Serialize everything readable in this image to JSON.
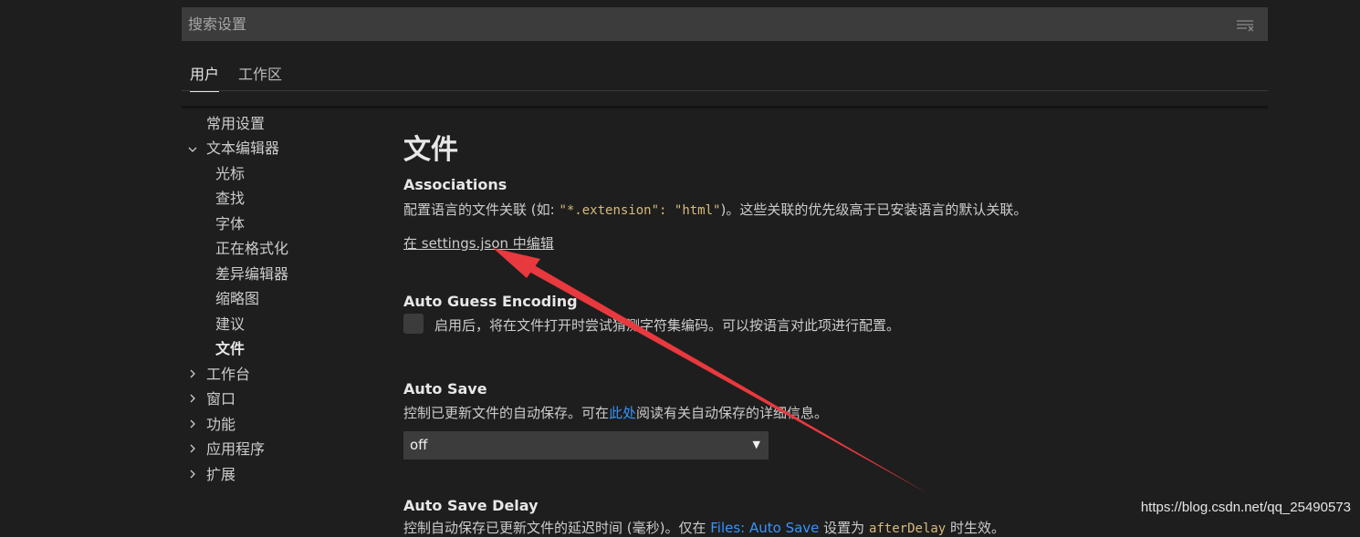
{
  "search": {
    "placeholder": "搜索设置",
    "value": ""
  },
  "tabs": [
    {
      "label": "用户",
      "active": true
    },
    {
      "label": "工作区",
      "active": false
    }
  ],
  "toc": [
    {
      "label": "常用设置"
    },
    {
      "label": "文本编辑器",
      "expanded": true
    },
    {
      "label": "光标"
    },
    {
      "label": "查找"
    },
    {
      "label": "字体"
    },
    {
      "label": "正在格式化"
    },
    {
      "label": "差异编辑器"
    },
    {
      "label": "缩略图"
    },
    {
      "label": "建议"
    },
    {
      "label": "文件",
      "selected": true
    },
    {
      "label": "工作台",
      "expanded": false
    },
    {
      "label": "窗口",
      "expanded": false
    },
    {
      "label": "功能",
      "expanded": false
    },
    {
      "label": "应用程序",
      "expanded": false
    },
    {
      "label": "扩展",
      "expanded": false
    }
  ],
  "section_title": "文件",
  "settings": {
    "associations": {
      "title": "Associations",
      "desc_before": "配置语言的文件关联 (如: ",
      "desc_code": "\"*.extension\": \"html\"",
      "desc_after": ")。这些关联的优先级高于已安装语言的默认关联。",
      "edit_link": "在 settings.json 中编辑"
    },
    "auto_guess_encoding": {
      "title": "Auto Guess Encoding",
      "checked": false,
      "desc": "启用后，将在文件打开时尝试猜测字符集编码。可以按语言对此项进行配置。"
    },
    "auto_save": {
      "title": "Auto Save",
      "desc_before": "控制已更新文件的自动保存。可在",
      "desc_link": "此处",
      "desc_after": "阅读有关自动保存的详细信息。",
      "value": "off"
    },
    "auto_save_delay": {
      "title": "Auto Save Delay",
      "desc_before": "控制自动保存已更新文件的延迟时间 (毫秒)。仅在 ",
      "desc_link": "Files: Auto Save",
      "desc_mid": " 设置为 ",
      "desc_code": "afterDelay",
      "desc_after": " 时生效。"
    }
  },
  "watermark": "https://blog.csdn.net/qq_25490573",
  "colors": {
    "background": "#1e1e1e",
    "input_bg": "#3c3c3c",
    "link": "#3794ff",
    "code": "#d7ba7d",
    "annotation_arrow": "#e8393e"
  }
}
